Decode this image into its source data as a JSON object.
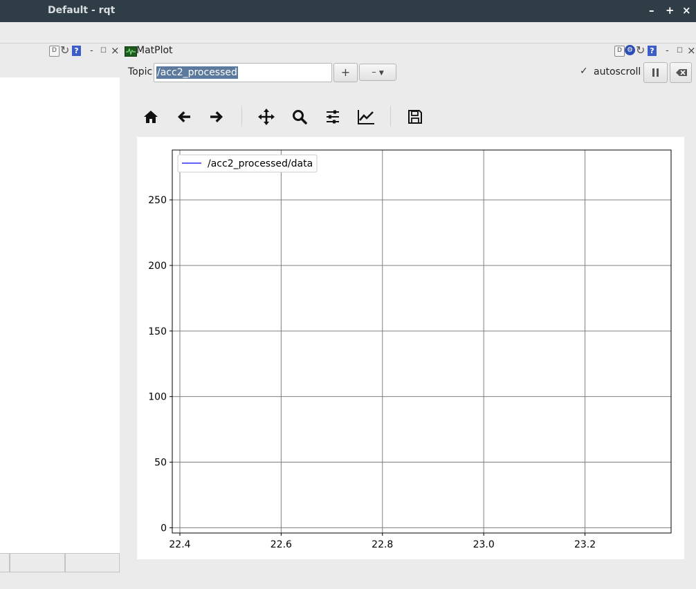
{
  "window": {
    "title": "Default - rqt",
    "minimize_label": "–",
    "maximize_label": "+",
    "close_label": "×"
  },
  "left_dock": {
    "float_label": "-",
    "undock_label": "☐",
    "close_label": "×"
  },
  "plugin": {
    "title": "MatPlot",
    "float_label": "-",
    "close_label": "×"
  },
  "toolbar": {
    "topic_label": "Topic",
    "topic_value": "/acc2_processed",
    "add_label": "+",
    "remove_label": "–",
    "autoscroll_label": "autoscroll",
    "autoscroll_checked": true
  },
  "icons": {
    "nav": [
      "home-icon",
      "back-icon",
      "forward-icon",
      "pan-icon",
      "zoom-icon",
      "configure-subplots-icon",
      "edit-curves-icon",
      "save-icon"
    ]
  },
  "chart_data": {
    "type": "line",
    "title": "",
    "xlabel": "",
    "ylabel": "",
    "xlim": [
      22.385,
      23.37
    ],
    "ylim": [
      -4,
      288
    ],
    "xticks": [
      22.4,
      22.6,
      22.8,
      23.0,
      23.2
    ],
    "xtick_labels": [
      "22.4",
      "22.6",
      "22.8",
      "23.0",
      "23.2"
    ],
    "yticks": [
      0,
      50,
      100,
      150,
      200,
      250
    ],
    "ytick_labels": [
      "0",
      "50",
      "100",
      "150",
      "200",
      "250"
    ],
    "grid": true,
    "legend_position": "top-left",
    "series": [
      {
        "name": "/acc2_processed/data",
        "color": "#0000ff",
        "x": [],
        "y": []
      }
    ]
  }
}
